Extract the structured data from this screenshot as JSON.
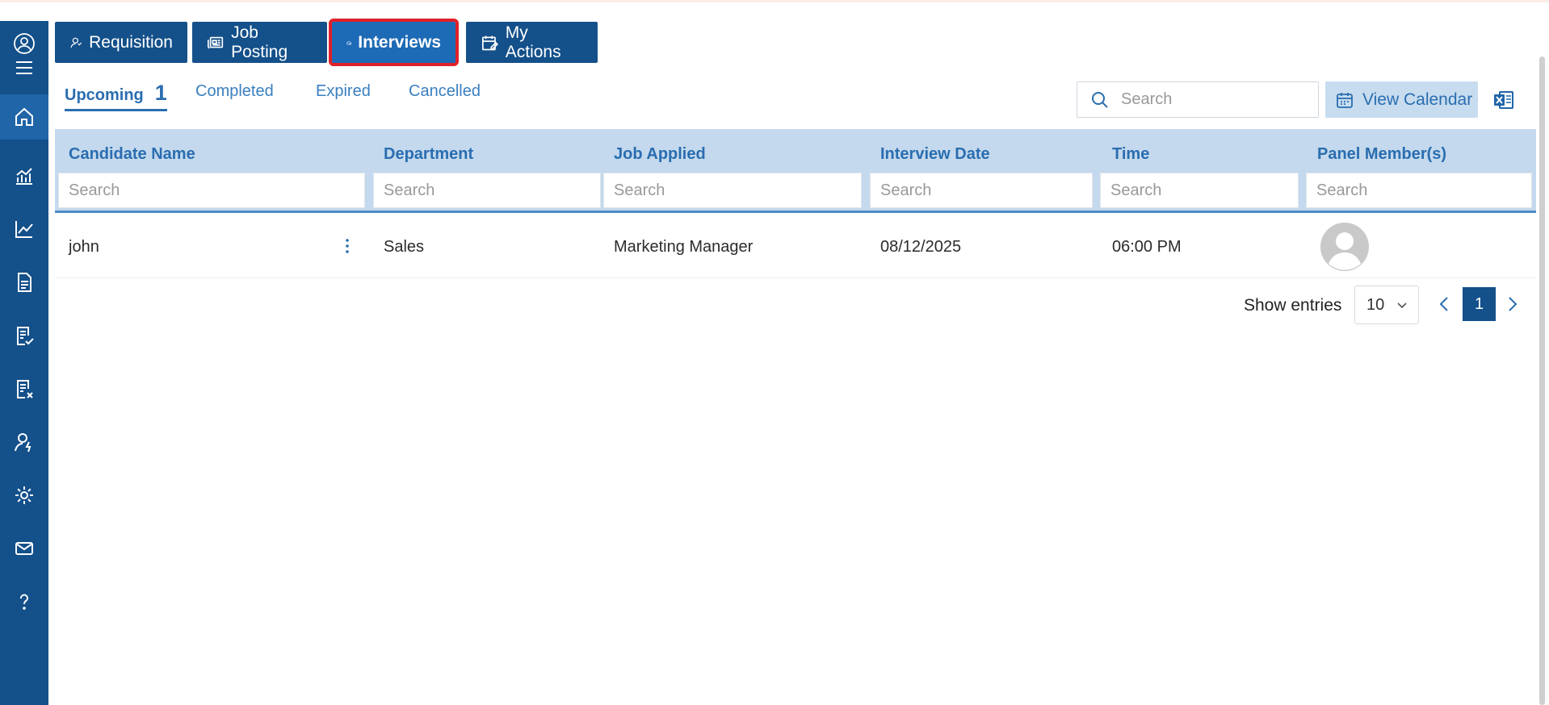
{
  "top_tabs": [
    {
      "label": "Requisition",
      "icon": "user-icon"
    },
    {
      "label": "Job Posting",
      "icon": "newspaper-icon"
    },
    {
      "label": "Interviews",
      "icon": "envelope-open-user-icon",
      "active": true
    },
    {
      "label": "My Actions",
      "icon": "calendar-edit-icon"
    }
  ],
  "sub_tabs": {
    "upcoming": {
      "label": "Upcoming",
      "count": "1"
    },
    "completed": {
      "label": "Completed"
    },
    "expired": {
      "label": "Expired"
    },
    "cancelled": {
      "label": "Cancelled"
    }
  },
  "toolbar": {
    "search_placeholder": "Search",
    "view_calendar_label": "View Calendar"
  },
  "table": {
    "columns": [
      "Candidate Name",
      "Department",
      "Job Applied",
      "Interview Date",
      "Time",
      "Panel Member(s)"
    ],
    "filter_placeholder": "Search",
    "rows": [
      {
        "candidate": "john",
        "department": "Sales",
        "job": "Marketing Manager",
        "date": "08/12/2025",
        "time": "06:00 PM"
      }
    ]
  },
  "pagination": {
    "show_entries_label": "Show entries",
    "entries_value": "10",
    "current_page": "1"
  },
  "colors": {
    "sidebar": "#14508a",
    "tab_active": "#1d6ab6",
    "highlight": "#e0202a",
    "header_bg": "#c4d9ed",
    "accent_text": "#2a6db0"
  }
}
